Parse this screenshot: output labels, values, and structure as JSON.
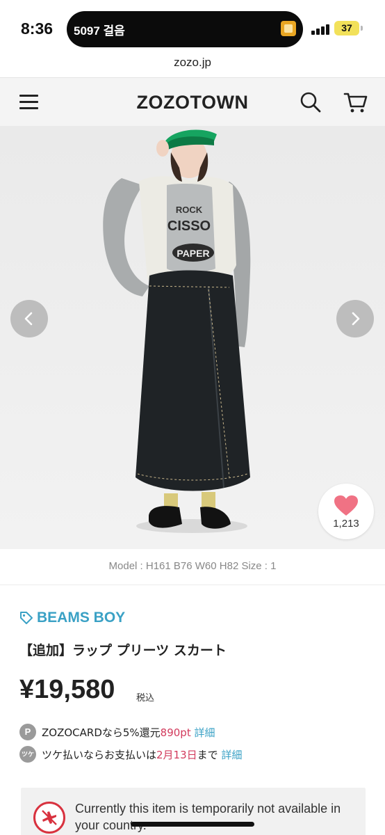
{
  "status_bar": {
    "time": "8:36",
    "island_text": "5097 걸음",
    "battery": "37",
    "icons": [
      "signal-icon",
      "battery-icon",
      "app-badge-icon"
    ]
  },
  "browser": {
    "url": "zozo.jp"
  },
  "header": {
    "logo": "ZOZOTOWN",
    "icons": [
      "hamburger-menu-icon",
      "search-icon",
      "cart-icon"
    ]
  },
  "gallery": {
    "favorite_count": "1,213",
    "model_info": "Model : H161  B76  W60  H82    Size : 1",
    "icons": [
      "chevron-left-icon",
      "chevron-right-icon",
      "heart-icon"
    ]
  },
  "product": {
    "brand": "BEAMS BOY",
    "title": "【追加】ラップ プリーツ スカート",
    "price": "¥19,580",
    "tax_label": "税込"
  },
  "promos": [
    {
      "icon_text": "P",
      "text_before": "ZOZOCARDなら5%還元",
      "highlight": "890pt",
      "text_after": "",
      "link": "詳細"
    },
    {
      "icon_text": "ツケ",
      "text_before": "ツケ払いならお支払いは",
      "highlight": "2月13日",
      "text_after": "まで",
      "link": "詳細"
    }
  ],
  "notice": {
    "text": "Currently this item is temporarily not available in your country.",
    "icon": "no-shipping-icon"
  },
  "colors": {
    "brand_link": "#3aa1c5",
    "accent_red": "#d23a5c",
    "heart": "#f07284",
    "notice_icon": "#d8323f",
    "header_bg": "#f4f4f4"
  }
}
